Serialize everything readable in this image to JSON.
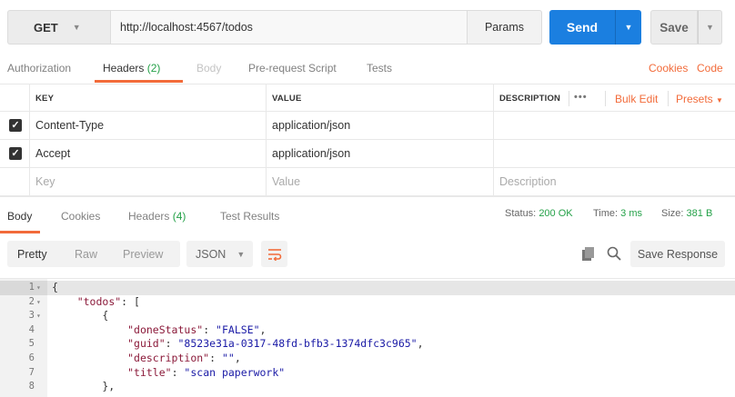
{
  "request": {
    "method": "GET",
    "url": "http://localhost:4567/todos",
    "params_label": "Params",
    "send_label": "Send",
    "save_label": "Save"
  },
  "request_tabs": {
    "authorization": "Authorization",
    "headers": "Headers",
    "headers_count": "(2)",
    "body": "Body",
    "pre_request": "Pre-request Script",
    "tests": "Tests",
    "cookies": "Cookies",
    "code": "Code"
  },
  "headers_table": {
    "col_key": "KEY",
    "col_value": "VALUE",
    "col_description": "DESCRIPTION",
    "more": "•••",
    "bulk_edit": "Bulk Edit",
    "presets": "Presets",
    "rows": [
      {
        "key": "Content-Type",
        "value": "application/json",
        "checked": true
      },
      {
        "key": "Accept",
        "value": "application/json",
        "checked": true
      }
    ],
    "placeholder_key": "Key",
    "placeholder_value": "Value",
    "placeholder_description": "Description"
  },
  "response_tabs": {
    "body": "Body",
    "cookies": "Cookies",
    "headers": "Headers",
    "headers_count": "(4)",
    "test_results": "Test Results",
    "status_label": "Status:",
    "status_value": "200 OK",
    "time_label": "Time:",
    "time_value": "3 ms",
    "size_label": "Size:",
    "size_value": "381 B"
  },
  "toolbar": {
    "pretty": "Pretty",
    "raw": "Raw",
    "preview": "Preview",
    "format": "JSON",
    "save_response": "Save Response"
  },
  "code_lines": [
    {
      "n": "1",
      "fold": true,
      "text": "{"
    },
    {
      "n": "2",
      "fold": true,
      "indent": "    ",
      "key": "\"todos\"",
      "rest": ": ["
    },
    {
      "n": "3",
      "fold": true,
      "text": "        {"
    },
    {
      "n": "4",
      "indent": "            ",
      "key": "\"doneStatus\"",
      "sep": ": ",
      "str": "\"FALSE\"",
      "tail": ","
    },
    {
      "n": "5",
      "indent": "            ",
      "key": "\"guid\"",
      "sep": ": ",
      "str": "\"8523e31a-0317-48fd-bfb3-1374dfc3c965\"",
      "tail": ","
    },
    {
      "n": "6",
      "indent": "            ",
      "key": "\"description\"",
      "sep": ": ",
      "str": "\"\"",
      "tail": ","
    },
    {
      "n": "7",
      "indent": "            ",
      "key": "\"title\"",
      "sep": ": ",
      "str": "\"scan paperwork\"",
      "tail": ""
    },
    {
      "n": "8",
      "text": "        },"
    }
  ],
  "colors": {
    "accent": "#f26b3a",
    "send_blue": "#1b7fe0",
    "ok_green": "#24a148"
  }
}
